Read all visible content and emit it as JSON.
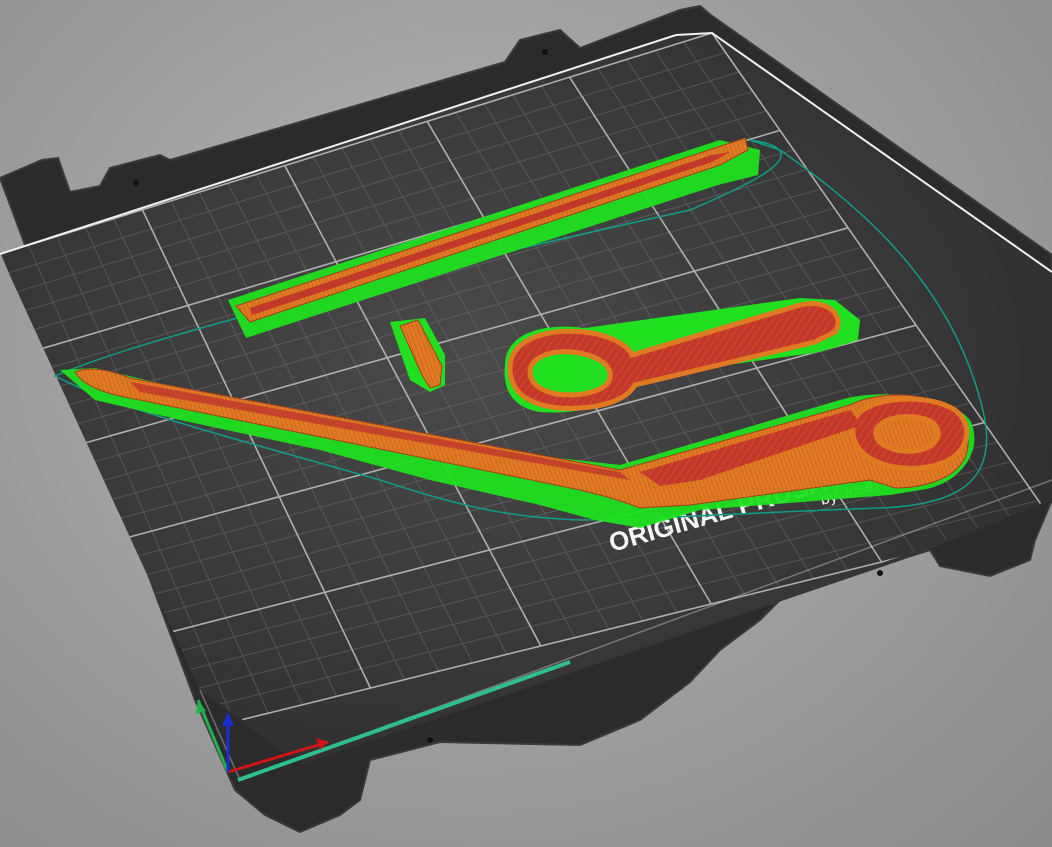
{
  "scene": {
    "type": "3d-print-preview",
    "background_color": "#a3a3a3",
    "bed": {
      "plate_color": "#2b2b2b",
      "print_area_color": "#363636",
      "grid_color": "#8c8c8c",
      "border_color": "#ffffff",
      "logo_line1": "ORIGINAL PRUSA i3 MK3",
      "logo_line2": "by Josef Prusa"
    },
    "axes": {
      "x_color": "#d01515",
      "y_color": "#22b14c",
      "z_color": "#1a2ed0"
    },
    "preview_colors": {
      "perimeter": "#e6781e",
      "infill": "#c0392b",
      "support": "#20e020",
      "skirt": "#0f9d86"
    },
    "objects": [
      {
        "name": "long-bar"
      },
      {
        "name": "small-pin"
      },
      {
        "name": "wrench-small"
      },
      {
        "name": "wrench-large"
      }
    ]
  }
}
